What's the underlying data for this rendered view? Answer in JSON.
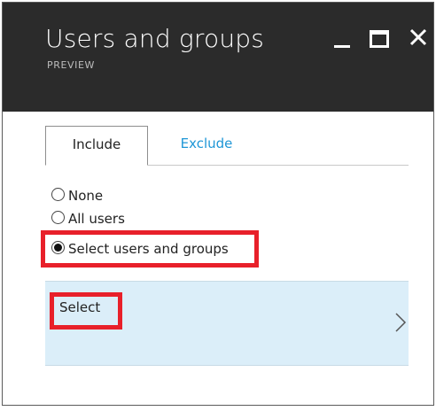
{
  "window": {
    "title": "Users and groups",
    "subtitle": "PREVIEW"
  },
  "tabs": [
    {
      "label": "Include",
      "active": true
    },
    {
      "label": "Exclude",
      "active": false
    }
  ],
  "options": [
    {
      "label": "None",
      "checked": false
    },
    {
      "label": "All users",
      "checked": false
    },
    {
      "label": "Select users and groups",
      "checked": true
    }
  ],
  "select_panel": {
    "label": "Select"
  },
  "colors": {
    "header_bg": "#2b2b2b",
    "accent": "#1e96d6",
    "highlight": "#e8202a",
    "panel_bg": "#dbeef9"
  },
  "icons": {
    "minimize": "minimize-icon",
    "maximize": "maximize-icon",
    "close": "close-icon",
    "chevron": "chevron-right-icon"
  }
}
